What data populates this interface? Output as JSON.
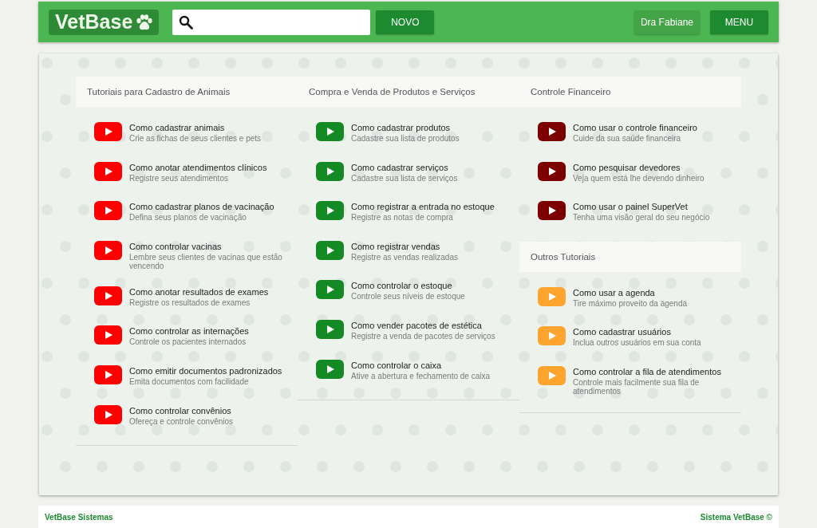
{
  "header": {
    "logo": "VetBase",
    "new_button": "NOVO",
    "user_button": "Dra Fabiane",
    "menu_button": "MENU"
  },
  "columns": [
    {
      "sections": [
        {
          "title": "Tutoriais para Cadastro de Animais",
          "color": "#ff0000",
          "items": [
            {
              "title": "Como cadastrar animais",
              "subtitle": "Crie as fichas de seus clientes e pets"
            },
            {
              "title": "Como anotar atendimentos clínicos",
              "subtitle": "Registre seus atendimentos"
            },
            {
              "title": "Como cadastrar planos de vacinação",
              "subtitle": "Defina seus planos de vacinação"
            },
            {
              "title": "Como controlar vacinas",
              "subtitle": "Lembre seus clientes de vacinas que estão vencendo"
            },
            {
              "title": "Como anotar resultados de exames",
              "subtitle": "Registre os resultados de exames"
            },
            {
              "title": "Como controlar as internações",
              "subtitle": "Controle os pacientes internados"
            },
            {
              "title": "Como emitir documentos padronizados",
              "subtitle": "Emita documentos com facilidade"
            },
            {
              "title": "Como controlar convênios",
              "subtitle": "Ofereça e controle convênios"
            }
          ]
        }
      ]
    },
    {
      "sections": [
        {
          "title": "Compra e Venda de Produtos e Serviços",
          "color": "#138a24",
          "items": [
            {
              "title": "Como cadastrar produtos",
              "subtitle": "Cadastre sua lista de produtos"
            },
            {
              "title": "Como cadastrar serviços",
              "subtitle": "Cadastre sua lista de serviços"
            },
            {
              "title": "Como registrar a entrada no estoque",
              "subtitle": "Registre as notas de compra"
            },
            {
              "title": "Como registrar vendas",
              "subtitle": "Registre as vendas realizadas"
            },
            {
              "title": "Como controlar o estoque",
              "subtitle": "Controle seus níveis de estoque"
            },
            {
              "title": "Como vender pacotes de estética",
              "subtitle": "Registre a venda de pacotes de serviços"
            },
            {
              "title": "Como controlar o caixa",
              "subtitle": "Ative a abertura e fechamento de caixa"
            }
          ]
        }
      ]
    },
    {
      "sections": [
        {
          "title": "Controle Financeiro",
          "color": "#7d0000",
          "items": [
            {
              "title": "Como usar o controle financeiro",
              "subtitle": "Cuide da sua saúde financeira"
            },
            {
              "title": "Como pesquisar devedores",
              "subtitle": "Veja quem está lhe devendo dinheiro"
            },
            {
              "title": "Como usar o painel SuperVet",
              "subtitle": "Tenha uma visão geral do seu negócio"
            }
          ]
        },
        {
          "title": "Outros Tutoriais",
          "color": "#ffa42e",
          "items": [
            {
              "title": "Como usar a agenda",
              "subtitle": "Tire máximo proveito da agenda"
            },
            {
              "title": "Como cadastrar usuários",
              "subtitle": "Inclua outros usuários em sua conta"
            },
            {
              "title": "Como controlar a fila de atendimentos",
              "subtitle": "Controle mais facilmente sua fila de atendimentos"
            }
          ]
        }
      ]
    }
  ],
  "footer": {
    "left": "VetBase Sistemas",
    "right": "Sistema VetBase ©"
  }
}
